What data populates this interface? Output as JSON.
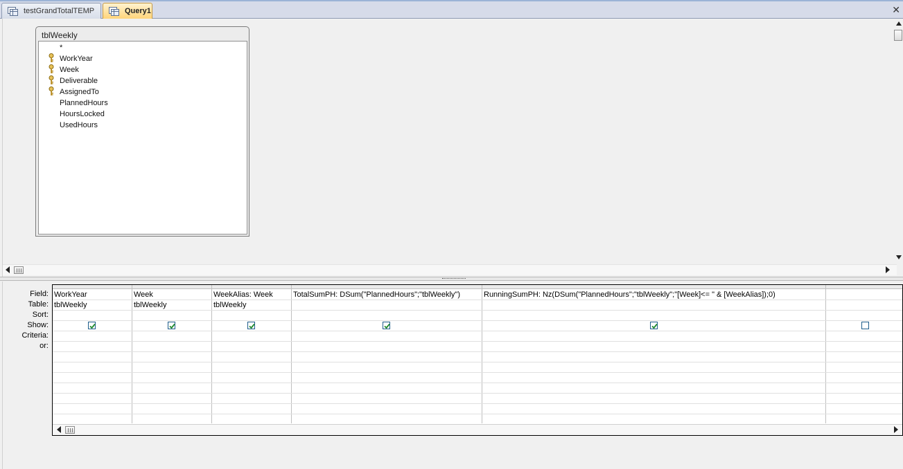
{
  "tabs": [
    {
      "label": "testGrandTotalTEMP",
      "active": false
    },
    {
      "label": "Query1",
      "active": true
    }
  ],
  "close_symbol": "✕",
  "table": {
    "title": "tblWeekly",
    "fields": [
      {
        "name": "*",
        "key": false
      },
      {
        "name": "WorkYear",
        "key": true
      },
      {
        "name": "Week",
        "key": true
      },
      {
        "name": "Deliverable",
        "key": true
      },
      {
        "name": "AssignedTo",
        "key": true
      },
      {
        "name": "PlannedHours",
        "key": false
      },
      {
        "name": "HoursLocked",
        "key": false
      },
      {
        "name": "UsedHours",
        "key": false
      }
    ]
  },
  "grid": {
    "row_labels": [
      "Field:",
      "Table:",
      "Sort:",
      "Show:",
      "Criteria:",
      "or:"
    ],
    "columns": [
      {
        "field": "WorkYear",
        "table": "tblWeekly",
        "show": true
      },
      {
        "field": "Week",
        "table": "tblWeekly",
        "show": true
      },
      {
        "field": "WeekAlias: Week",
        "table": "tblWeekly",
        "show": true
      },
      {
        "field": "TotalSumPH: DSum(\"PlannedHours\";\"tblWeekly\")",
        "table": "",
        "show": true
      },
      {
        "field": "RunningSumPH: Nz(DSum(\"PlannedHours\";\"tblWeekly\";\"[Week]<= \" & [WeekAlias]);0)",
        "table": "",
        "show": true
      },
      {
        "field": "",
        "table": "",
        "show": false
      }
    ]
  },
  "colors": {
    "active_tab": "#ffd47a",
    "checkbox_border": "#1d5c8a",
    "check_mark": "#1e8a2e",
    "key_icon": "#c9a227"
  },
  "icons": {
    "tab": "query-tab-icon",
    "key": "primary-key-icon",
    "close": "close-icon"
  }
}
